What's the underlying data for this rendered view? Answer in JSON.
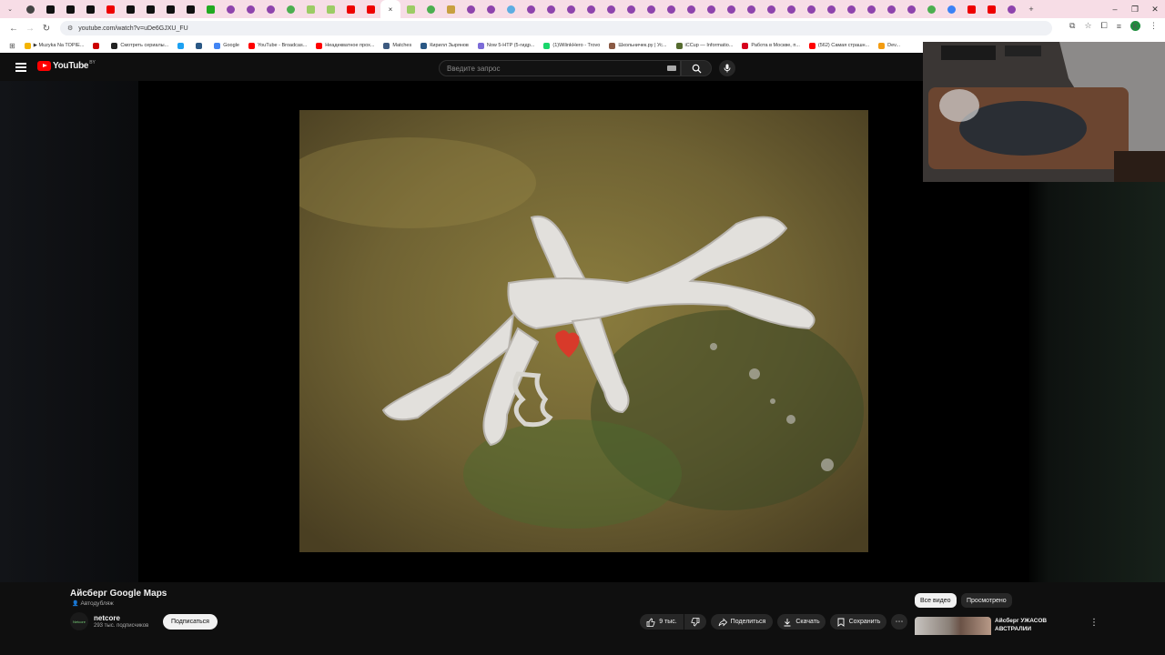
{
  "browser": {
    "url": "youtube.com/watch?v=uDe6GJXU_FU",
    "bookmarks": [
      {
        "label": "▶ Muzyka Na TOPIE...",
        "color": "#f4b400"
      },
      {
        "label": "",
        "color": "#cc0000"
      },
      {
        "label": "Смотреть сериалы...",
        "color": "#222222"
      },
      {
        "label": "",
        "color": "#1da1f2"
      },
      {
        "label": "",
        "color": "#2a5885"
      },
      {
        "label": "Google",
        "color": "#4285f4"
      },
      {
        "label": "YouTube - Broadcas...",
        "color": "#ff0000"
      },
      {
        "label": "Неадекватное прох...",
        "color": "#ff0000"
      },
      {
        "label": "Matches",
        "color": "#3d5a80"
      },
      {
        "label": "Кирилл Зырянов",
        "color": "#2a5885"
      },
      {
        "label": "Now 5-HTP (5-гидр...",
        "color": "#7c6cd8"
      },
      {
        "label": "(1)WilinkHero - Trovo",
        "color": "#19d66b"
      },
      {
        "label": "Школьничек.ру | Ус...",
        "color": "#8a5a44"
      },
      {
        "label": "iCCup — Informatio...",
        "color": "#556b2f"
      },
      {
        "label": "Работа в Москве, п...",
        "color": "#d6001c"
      },
      {
        "label": "(562) Самая страшн...",
        "color": "#ff0000"
      },
      {
        "label": "Dev...",
        "color": "#f39c12"
      }
    ]
  },
  "header": {
    "logo_text": "YouTube",
    "country_code": "BY",
    "search_placeholder": "Введите запрос"
  },
  "video": {
    "title": "Айсберг Google Maps",
    "dub_label": "Автодубляж"
  },
  "channel": {
    "name": "netcore",
    "avatar_text": "Netcore",
    "subscribers": "293 тыс. подписчиков",
    "subscribe_label": "Подписаться"
  },
  "actions": {
    "likes": "9 тыс.",
    "share_label": "Поделиться",
    "download_label": "Скачать",
    "save_label": "Сохранить"
  },
  "sidebar": {
    "chips": [
      "Все видео",
      "Просмотрено"
    ],
    "recommendation_title": "Айсберг УЖАСОВ АВСТРАЛИИ"
  }
}
